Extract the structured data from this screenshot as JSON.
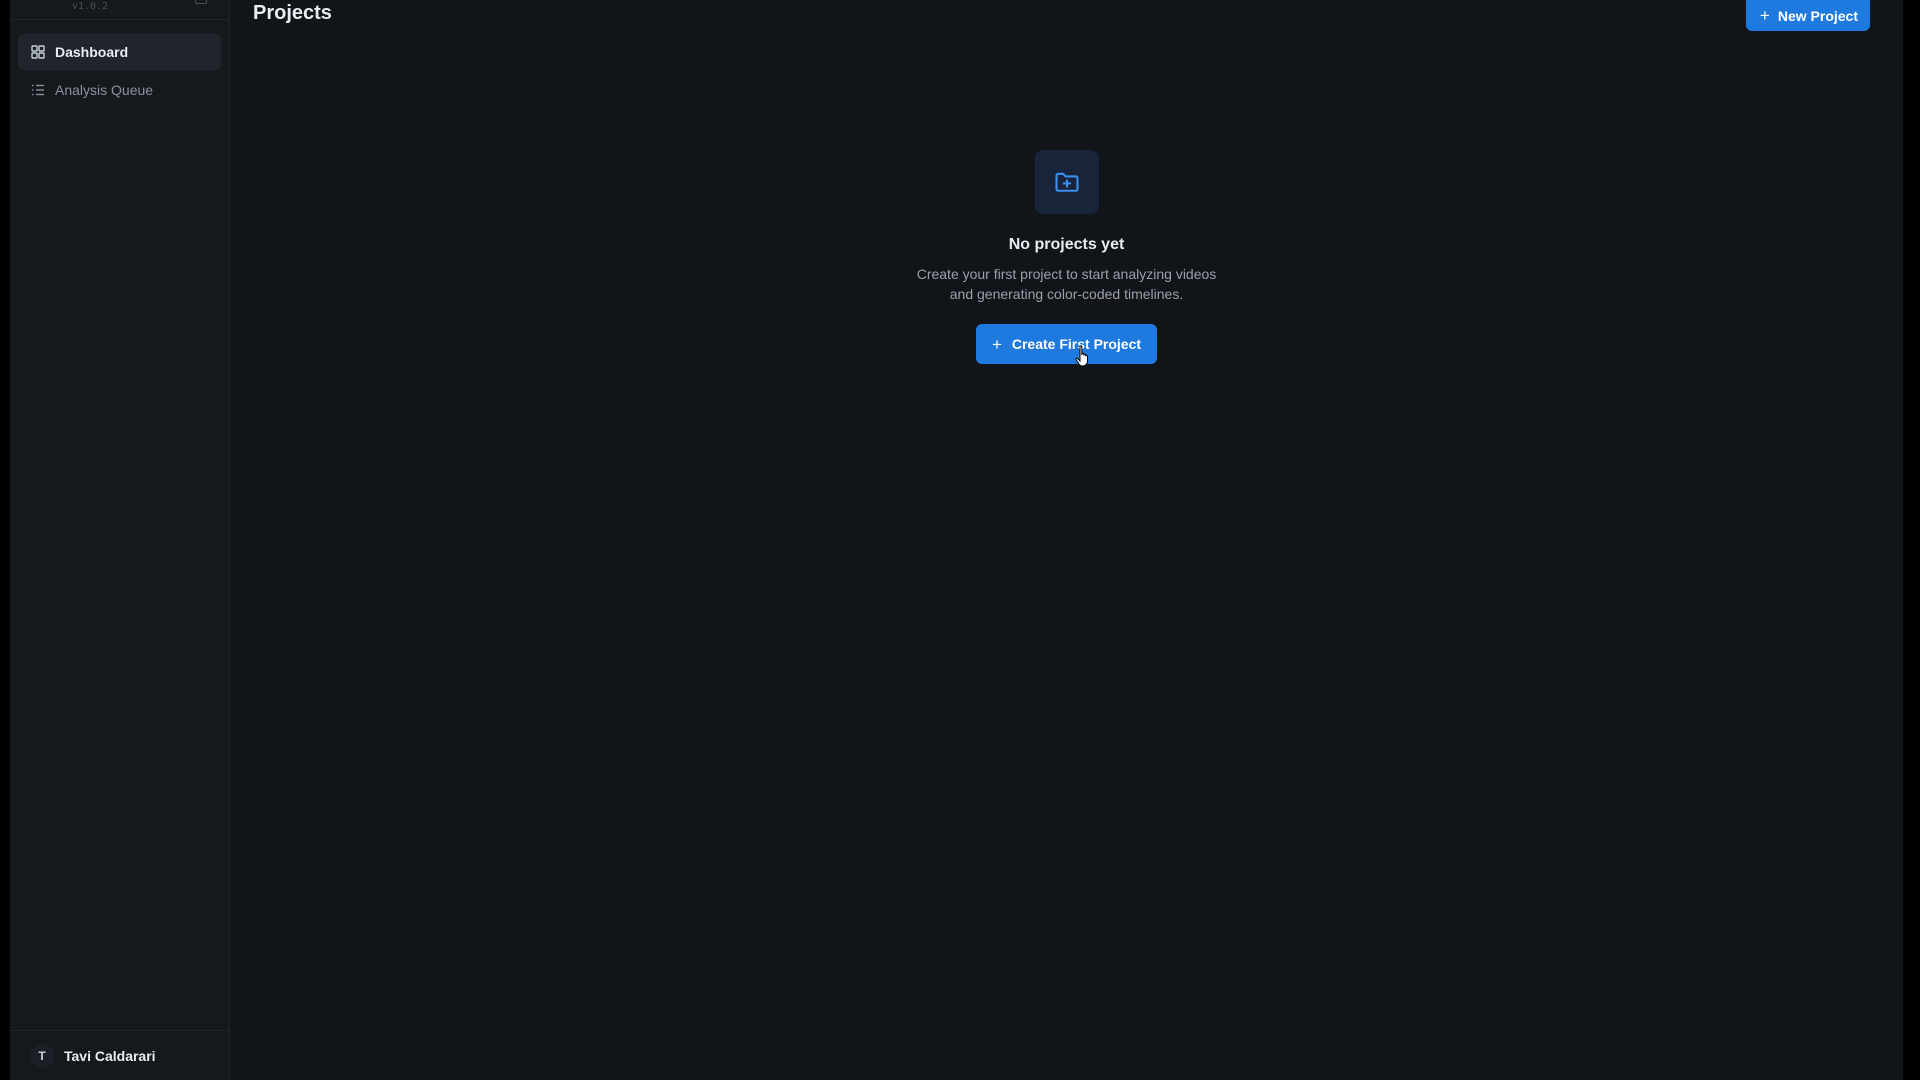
{
  "sidebar": {
    "version": "v1.0.2",
    "items": [
      {
        "label": "Dashboard",
        "icon": "dashboard-grid-icon",
        "active": true
      },
      {
        "label": "Analysis Queue",
        "icon": "list-icon",
        "active": false
      }
    ],
    "user": {
      "initial": "T",
      "name": "Tavi Caldarari"
    }
  },
  "header": {
    "title": "Projects",
    "new_project_label": "New Project"
  },
  "empty_state": {
    "icon": "folder-plus-icon",
    "title": "No projects yet",
    "description": "Create your first project to start analyzing videos and generating color-coded timelines.",
    "cta_label": "Create First Project"
  },
  "colors": {
    "accent": "#1f7ae0",
    "background": "#111418",
    "sidebar": "#15181c"
  }
}
